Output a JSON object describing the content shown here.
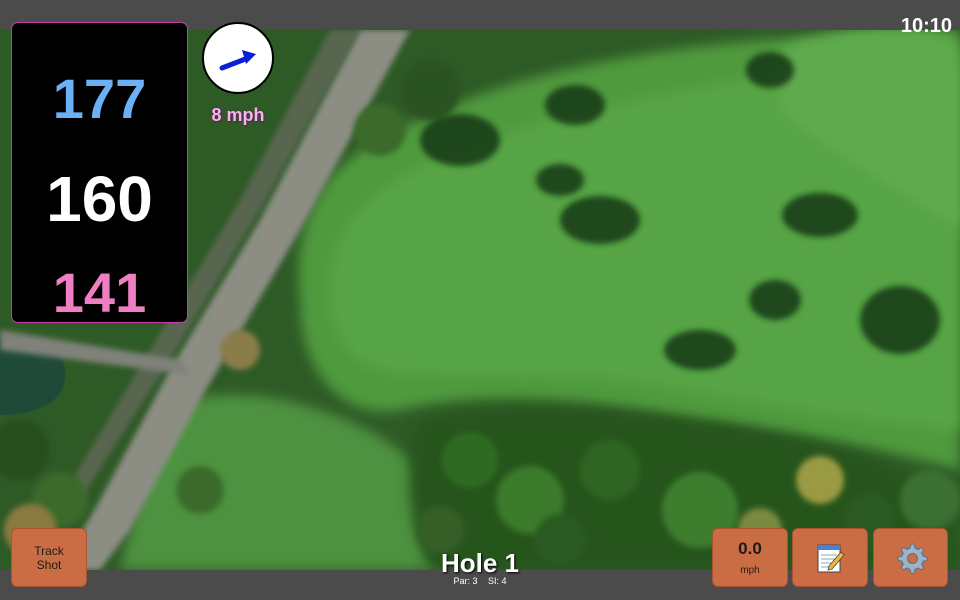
{
  "status": {
    "time": "10:10"
  },
  "distances": {
    "back": "177",
    "middle": "160",
    "front": "141"
  },
  "wind": {
    "speed": "8 mph",
    "direction": "east-north-east"
  },
  "hole": {
    "title": "Hole 1",
    "par": "Par: 3",
    "si": "SI: 4"
  },
  "buttons": {
    "track_line1": "Track",
    "track_line2": "Shot",
    "wind_value": "0.0",
    "wind_unit": "mph",
    "notes_icon": "notepad-icon",
    "settings_icon": "gear-icon"
  },
  "colors": {
    "back_distance": "#6ab1f6",
    "middle_distance": "#ffffff",
    "front_distance": "#f07ec3",
    "button": "#cb6d44",
    "wind_label": "#f7b3ec"
  }
}
